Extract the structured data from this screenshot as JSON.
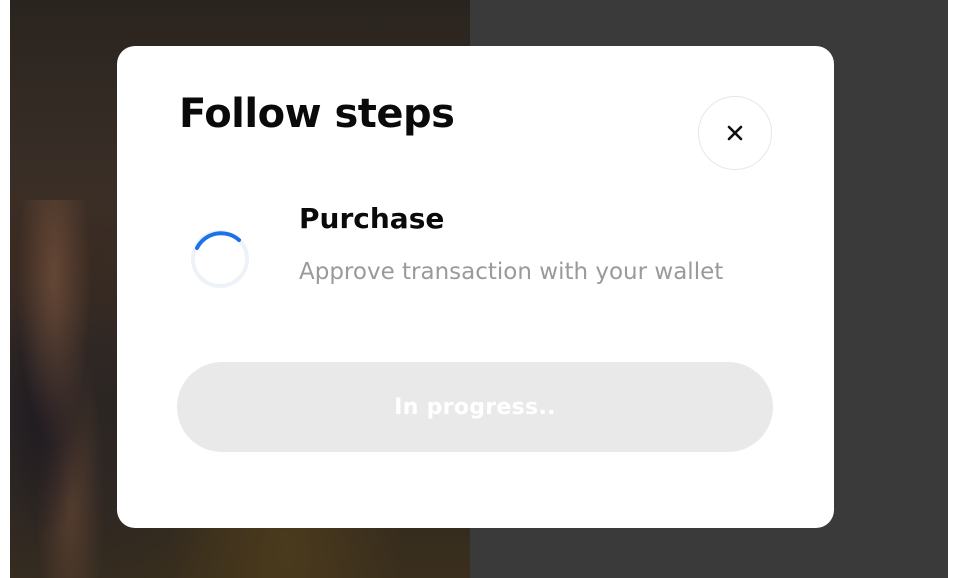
{
  "modal": {
    "title": "Follow steps",
    "close_icon": "close-icon",
    "steps": [
      {
        "status_icon": "loading-spinner-icon",
        "title": "Purchase",
        "description": "Approve transaction with your wallet"
      }
    ],
    "action_button": {
      "label": "In progress..",
      "disabled": true
    }
  },
  "colors": {
    "accent": "#1a73e8",
    "button_disabled_bg": "#e9e9e9",
    "muted_text": "#9a9a9a",
    "backdrop_overlay": "#3a3a3a"
  }
}
